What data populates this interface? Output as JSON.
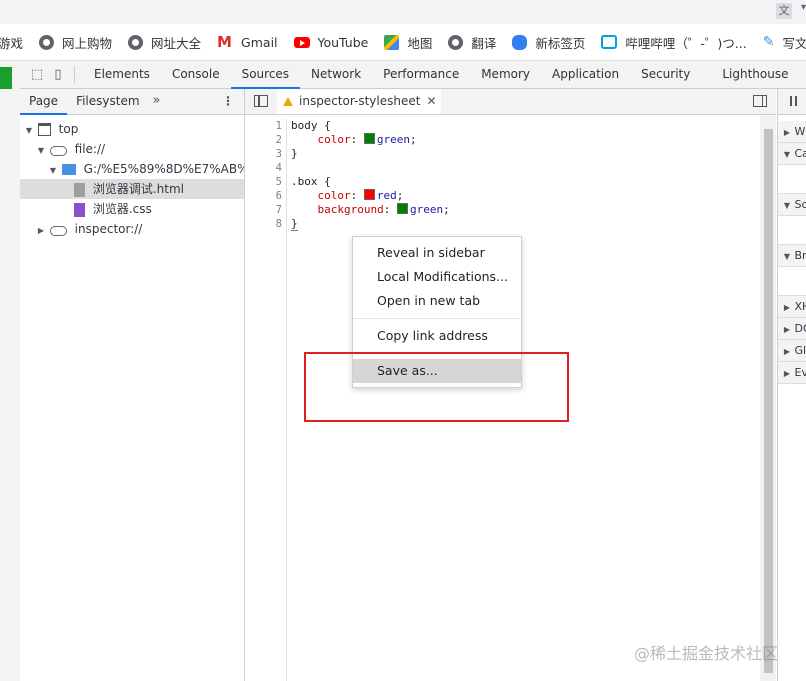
{
  "bookmarks": [
    {
      "label": "游戏",
      "icon": "game-icon"
    },
    {
      "label": "网上购物",
      "icon": "globe-icon"
    },
    {
      "label": "网址大全",
      "icon": "globe-icon"
    },
    {
      "label": "Gmail",
      "icon": "gmail-icon"
    },
    {
      "label": "YouTube",
      "icon": "youtube-icon"
    },
    {
      "label": "地图",
      "icon": "maps-icon"
    },
    {
      "label": "翻译",
      "icon": "globe-icon"
    },
    {
      "label": "新标签页",
      "icon": "paw-icon"
    },
    {
      "label": "哔哩哔哩（゜-゜)つ...",
      "icon": "bilibili-icon"
    },
    {
      "label": "写文章",
      "icon": "pen-icon"
    }
  ],
  "devtools": {
    "tabs": [
      "Elements",
      "Console",
      "Sources",
      "Network",
      "Performance",
      "Memory",
      "Application",
      "Security",
      "Lighthouse"
    ],
    "active_tab": "Sources",
    "navigator": {
      "tabs": [
        "Page",
        "Filesystem"
      ],
      "more": "»",
      "kebab": "⋮",
      "tree": {
        "top": "top",
        "file": "file://",
        "folder": "G:/%E5%89%8D%E7%AB%AF%",
        "file_html": "浏览器调试.html",
        "file_css": "浏览器.css",
        "inspector": "inspector://"
      }
    },
    "editor": {
      "tab_label": "inspector-stylesheet",
      "close": "✕",
      "line_numbers": [
        "1",
        "2",
        "3",
        "4",
        "5",
        "6",
        "7",
        "8"
      ],
      "code": {
        "l1_selector": "body {",
        "l2_prop": "color",
        "l2_val": "green",
        "l3": "}",
        "l5_selector": ".box {",
        "l6_prop": "color",
        "l6_val": "red",
        "l7_prop": "background",
        "l7_val": "green",
        "l8": "}"
      }
    },
    "sidebar": {
      "panes": [
        "W",
        "Ca",
        "Sc",
        "Br",
        "XH",
        "DO",
        "Gl",
        "Ev"
      ]
    },
    "context_menu": {
      "items": [
        "Reveal in sidebar",
        "Local Modifications...",
        "Open in new tab",
        "Copy link address",
        "Save as..."
      ],
      "highlighted": "Save as..."
    }
  },
  "colors": {
    "accent": "#1a73e8",
    "highlight_box": "#e02020",
    "swatch_green": "#008000",
    "swatch_red": "#ff0000"
  },
  "watermark": "@稀土掘金技术社区"
}
